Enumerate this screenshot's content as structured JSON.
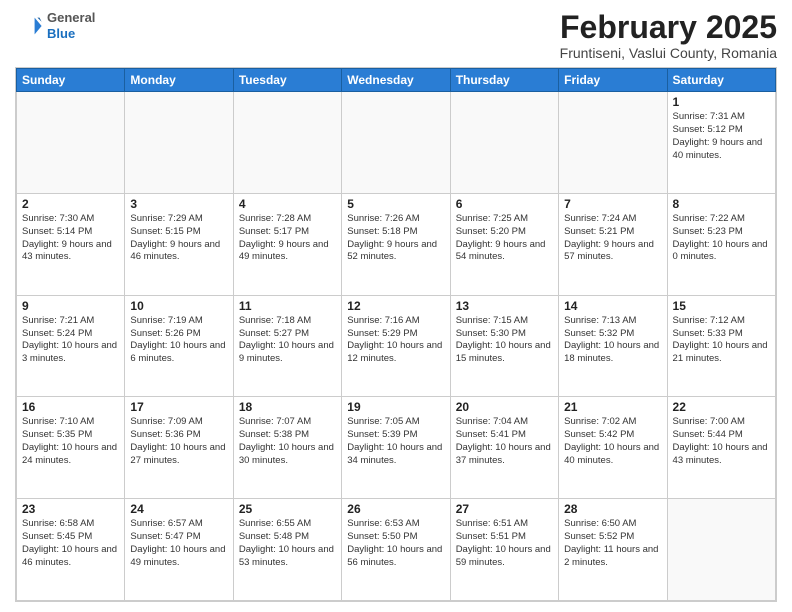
{
  "header": {
    "logo": {
      "general": "General",
      "blue": "Blue"
    },
    "title": "February 2025",
    "location": "Fruntiseni, Vaslui County, Romania"
  },
  "calendar": {
    "days_of_week": [
      "Sunday",
      "Monday",
      "Tuesday",
      "Wednesday",
      "Thursday",
      "Friday",
      "Saturday"
    ],
    "weeks": [
      [
        {
          "day": "",
          "info": ""
        },
        {
          "day": "",
          "info": ""
        },
        {
          "day": "",
          "info": ""
        },
        {
          "day": "",
          "info": ""
        },
        {
          "day": "",
          "info": ""
        },
        {
          "day": "",
          "info": ""
        },
        {
          "day": "1",
          "info": "Sunrise: 7:31 AM\nSunset: 5:12 PM\nDaylight: 9 hours and 40 minutes."
        }
      ],
      [
        {
          "day": "2",
          "info": "Sunrise: 7:30 AM\nSunset: 5:14 PM\nDaylight: 9 hours and 43 minutes."
        },
        {
          "day": "3",
          "info": "Sunrise: 7:29 AM\nSunset: 5:15 PM\nDaylight: 9 hours and 46 minutes."
        },
        {
          "day": "4",
          "info": "Sunrise: 7:28 AM\nSunset: 5:17 PM\nDaylight: 9 hours and 49 minutes."
        },
        {
          "day": "5",
          "info": "Sunrise: 7:26 AM\nSunset: 5:18 PM\nDaylight: 9 hours and 52 minutes."
        },
        {
          "day": "6",
          "info": "Sunrise: 7:25 AM\nSunset: 5:20 PM\nDaylight: 9 hours and 54 minutes."
        },
        {
          "day": "7",
          "info": "Sunrise: 7:24 AM\nSunset: 5:21 PM\nDaylight: 9 hours and 57 minutes."
        },
        {
          "day": "8",
          "info": "Sunrise: 7:22 AM\nSunset: 5:23 PM\nDaylight: 10 hours and 0 minutes."
        }
      ],
      [
        {
          "day": "9",
          "info": "Sunrise: 7:21 AM\nSunset: 5:24 PM\nDaylight: 10 hours and 3 minutes."
        },
        {
          "day": "10",
          "info": "Sunrise: 7:19 AM\nSunset: 5:26 PM\nDaylight: 10 hours and 6 minutes."
        },
        {
          "day": "11",
          "info": "Sunrise: 7:18 AM\nSunset: 5:27 PM\nDaylight: 10 hours and 9 minutes."
        },
        {
          "day": "12",
          "info": "Sunrise: 7:16 AM\nSunset: 5:29 PM\nDaylight: 10 hours and 12 minutes."
        },
        {
          "day": "13",
          "info": "Sunrise: 7:15 AM\nSunset: 5:30 PM\nDaylight: 10 hours and 15 minutes."
        },
        {
          "day": "14",
          "info": "Sunrise: 7:13 AM\nSunset: 5:32 PM\nDaylight: 10 hours and 18 minutes."
        },
        {
          "day": "15",
          "info": "Sunrise: 7:12 AM\nSunset: 5:33 PM\nDaylight: 10 hours and 21 minutes."
        }
      ],
      [
        {
          "day": "16",
          "info": "Sunrise: 7:10 AM\nSunset: 5:35 PM\nDaylight: 10 hours and 24 minutes."
        },
        {
          "day": "17",
          "info": "Sunrise: 7:09 AM\nSunset: 5:36 PM\nDaylight: 10 hours and 27 minutes."
        },
        {
          "day": "18",
          "info": "Sunrise: 7:07 AM\nSunset: 5:38 PM\nDaylight: 10 hours and 30 minutes."
        },
        {
          "day": "19",
          "info": "Sunrise: 7:05 AM\nSunset: 5:39 PM\nDaylight: 10 hours and 34 minutes."
        },
        {
          "day": "20",
          "info": "Sunrise: 7:04 AM\nSunset: 5:41 PM\nDaylight: 10 hours and 37 minutes."
        },
        {
          "day": "21",
          "info": "Sunrise: 7:02 AM\nSunset: 5:42 PM\nDaylight: 10 hours and 40 minutes."
        },
        {
          "day": "22",
          "info": "Sunrise: 7:00 AM\nSunset: 5:44 PM\nDaylight: 10 hours and 43 minutes."
        }
      ],
      [
        {
          "day": "23",
          "info": "Sunrise: 6:58 AM\nSunset: 5:45 PM\nDaylight: 10 hours and 46 minutes."
        },
        {
          "day": "24",
          "info": "Sunrise: 6:57 AM\nSunset: 5:47 PM\nDaylight: 10 hours and 49 minutes."
        },
        {
          "day": "25",
          "info": "Sunrise: 6:55 AM\nSunset: 5:48 PM\nDaylight: 10 hours and 53 minutes."
        },
        {
          "day": "26",
          "info": "Sunrise: 6:53 AM\nSunset: 5:50 PM\nDaylight: 10 hours and 56 minutes."
        },
        {
          "day": "27",
          "info": "Sunrise: 6:51 AM\nSunset: 5:51 PM\nDaylight: 10 hours and 59 minutes."
        },
        {
          "day": "28",
          "info": "Sunrise: 6:50 AM\nSunset: 5:52 PM\nDaylight: 11 hours and 2 minutes."
        },
        {
          "day": "",
          "info": ""
        }
      ]
    ]
  }
}
